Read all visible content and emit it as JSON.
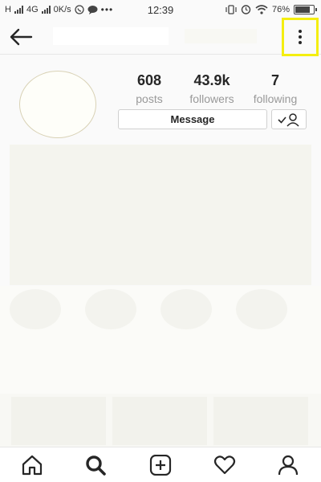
{
  "status_bar": {
    "network_h": "H",
    "network_4g": "4G",
    "speed": "0K/s",
    "time": "12:39",
    "battery": "76%",
    "battery_level": 0.76,
    "icons": [
      "signal-icon",
      "whatsapp-icon",
      "chat-icon",
      "more-dots-icon",
      "vibrate-icon",
      "alarm-icon",
      "wifi-icon",
      "battery-icon"
    ]
  },
  "header": {
    "back_icon": "arrow-left-icon",
    "menu_icon": "more-vertical-icon",
    "highlight_color": "#f4ee10"
  },
  "profile": {
    "stats": [
      {
        "value": "608",
        "label": "posts"
      },
      {
        "value": "43.9k",
        "label": "followers"
      },
      {
        "value": "7",
        "label": "following"
      }
    ],
    "message_label": "Message",
    "follow_icon": "user-check-icon"
  },
  "bottom_nav": {
    "items": [
      "home-icon",
      "search-icon",
      "add-post-icon",
      "heart-icon",
      "profile-icon"
    ]
  }
}
